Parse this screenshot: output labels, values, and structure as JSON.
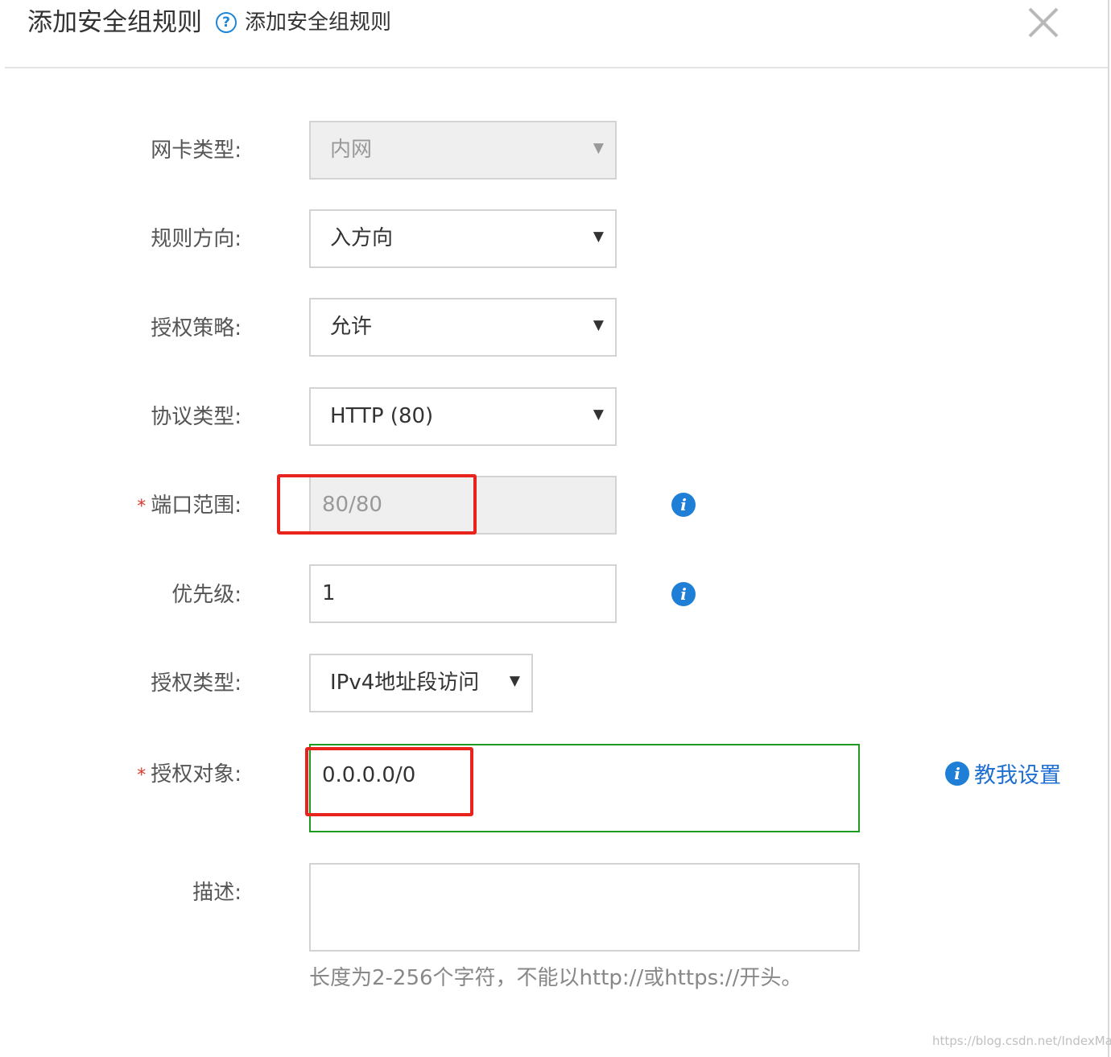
{
  "dialog": {
    "title": "添加安全组规则",
    "help_link": "添加安全组规则",
    "help_icon": "question-circle-icon",
    "close_icon": "close-icon"
  },
  "form": {
    "nic_type": {
      "label": "网卡类型:",
      "value": "内网",
      "disabled": true
    },
    "rule_direction": {
      "label": "规则方向:",
      "value": "入方向"
    },
    "auth_policy": {
      "label": "授权策略:",
      "value": "允许"
    },
    "protocol_type": {
      "label": "协议类型:",
      "value": "HTTP (80)"
    },
    "port_range": {
      "required_mark": "*",
      "label": "端口范围:",
      "value": "80/80",
      "disabled": true
    },
    "priority": {
      "label": "优先级:",
      "value": "1"
    },
    "auth_type": {
      "label": "授权类型:",
      "value": "IPv4地址段访问"
    },
    "auth_object": {
      "required_mark": "*",
      "label": "授权对象:",
      "value": "0.0.0.0/0",
      "teach_link": "教我设置"
    },
    "description": {
      "label": "描述:",
      "value": "",
      "hint": "长度为2-256个字符，不能以http://或https://开头。"
    }
  },
  "colors": {
    "accent": "#1f7fd6",
    "required": "#e0362b",
    "highlight": "#e8231c",
    "valid_border": "#1e9b1e"
  },
  "watermark": "https://blog.csdn.net/IndexMan"
}
